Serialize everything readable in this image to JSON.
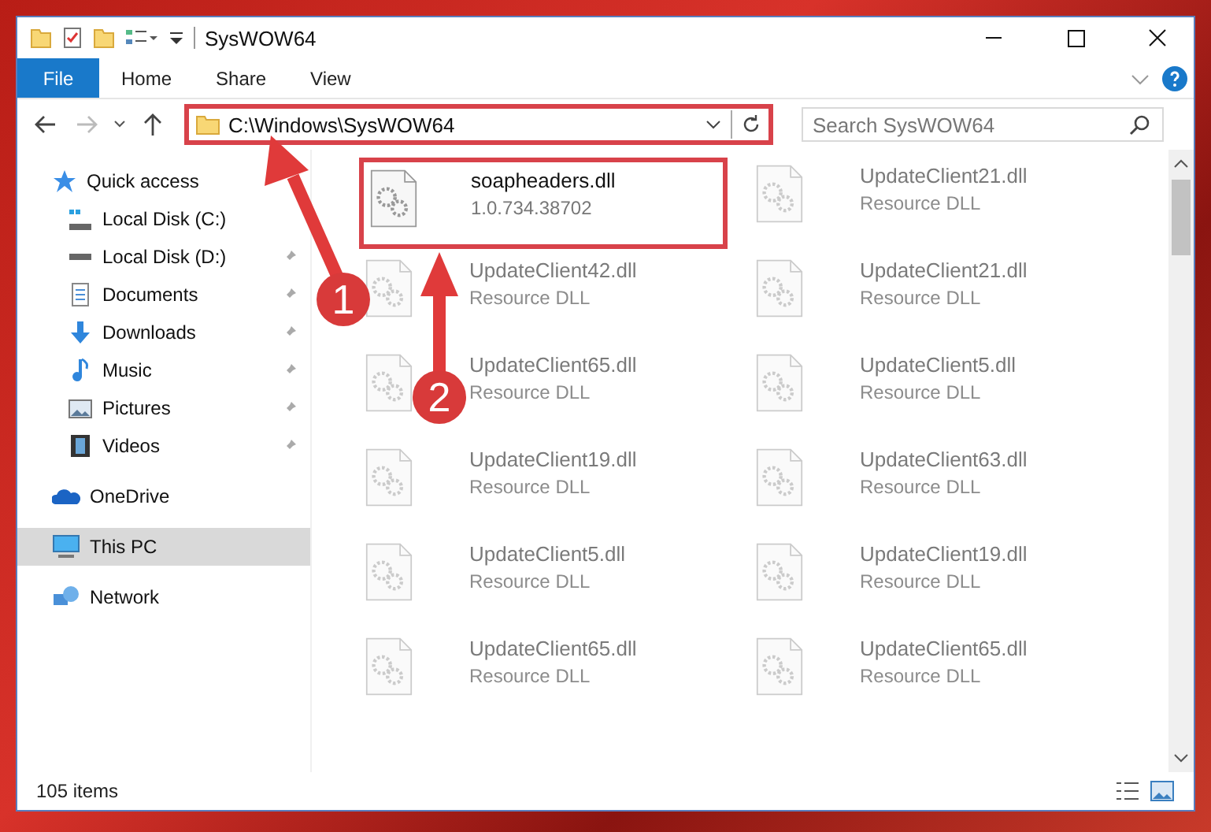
{
  "window": {
    "title": "SysWOW64"
  },
  "ribbon_tabs": [
    {
      "label": "File",
      "selected": true
    },
    {
      "label": "Home",
      "selected": false
    },
    {
      "label": "Share",
      "selected": false
    },
    {
      "label": "View",
      "selected": false
    }
  ],
  "address": {
    "path": "C:\\Windows\\SysWOW64",
    "highlighted": true
  },
  "search": {
    "placeholder": "Search SysWOW64"
  },
  "sidebar": {
    "items": [
      {
        "label": "Quick access",
        "selected": false,
        "children": [
          {
            "label": "Local Disk (C:)",
            "selected": false
          },
          {
            "label": "Local Disk (D:)",
            "pinned": true,
            "selected": false
          },
          {
            "label": "Documents",
            "pinned": true,
            "selected": false
          },
          {
            "label": "Downloads",
            "pinned": true,
            "selected": false
          },
          {
            "label": "Music",
            "pinned": true,
            "selected": false
          },
          {
            "label": "Pictures",
            "pinned": true,
            "selected": false
          },
          {
            "label": "Videos",
            "pinned": true,
            "selected": false
          }
        ]
      },
      {
        "label": "OneDrive",
        "selected": false
      },
      {
        "label": "This PC",
        "selected": true
      },
      {
        "label": "Network",
        "selected": false
      }
    ]
  },
  "files": [
    {
      "name": "soapheaders.dll",
      "detail": "1.0.734.38702",
      "dimmed": false,
      "highlighted": true
    },
    {
      "name": "UpdateClient21.dll",
      "detail": "Resource DLL",
      "dimmed": true,
      "highlighted": false
    },
    {
      "name": "UpdateClient42.dll",
      "detail": "Resource DLL",
      "dimmed": true,
      "highlighted": false
    },
    {
      "name": "UpdateClient21.dll",
      "detail": "Resource DLL",
      "dimmed": true,
      "highlighted": false
    },
    {
      "name": "UpdateClient65.dll",
      "detail": "Resource DLL",
      "dimmed": true,
      "highlighted": false
    },
    {
      "name": "UpdateClient5.dll",
      "detail": "Resource DLL",
      "dimmed": true,
      "highlighted": false
    },
    {
      "name": "UpdateClient19.dll",
      "detail": "Resource DLL",
      "dimmed": true,
      "highlighted": false
    },
    {
      "name": "UpdateClient63.dll",
      "detail": "Resource DLL",
      "dimmed": true,
      "highlighted": false
    },
    {
      "name": "UpdateClient5.dll",
      "detail": "Resource DLL",
      "dimmed": true,
      "highlighted": false
    },
    {
      "name": "UpdateClient19.dll",
      "detail": "Resource DLL",
      "dimmed": true,
      "highlighted": false
    },
    {
      "name": "UpdateClient65.dll",
      "detail": "Resource DLL",
      "dimmed": true,
      "highlighted": false
    },
    {
      "name": "UpdateClient65.dll",
      "detail": "Resource DLL",
      "dimmed": true,
      "highlighted": false
    }
  ],
  "status_bar": {
    "count": "105 items"
  },
  "annotations": [
    {
      "number": "1"
    },
    {
      "number": "2"
    }
  ]
}
